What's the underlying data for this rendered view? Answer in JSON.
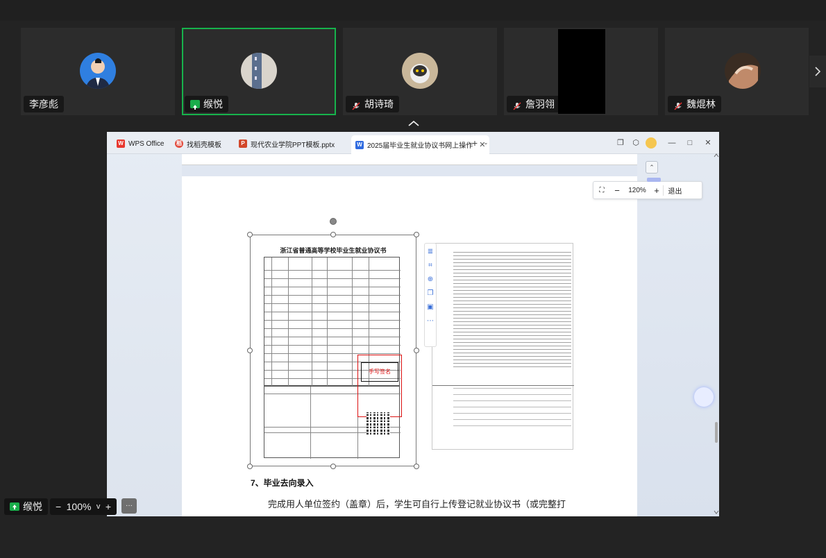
{
  "participants": [
    {
      "name": "李彦彪",
      "muted": false,
      "active": false
    },
    {
      "name": "缑悦",
      "muted": false,
      "active": true,
      "sharing": true
    },
    {
      "name": "胡诗琦",
      "muted": true,
      "active": false
    },
    {
      "name": "詹羽翎",
      "muted": true,
      "active": false
    },
    {
      "name": "魏焜林",
      "muted": true,
      "active": false
    }
  ],
  "browser_tabs": [
    {
      "label": "WPS Office",
      "icon": "wps-icon"
    },
    {
      "label": "找稻壳模板",
      "icon": "docer-icon"
    },
    {
      "label": "现代农业学院PPT模板.pptx",
      "icon": "ppt-icon"
    },
    {
      "label": "2025届毕业生就业协议书网上操作",
      "icon": "word-icon",
      "current": true
    }
  ],
  "zoom_toolbar": {
    "minus": "−",
    "value": "120%",
    "plus": "+",
    "exit": "退出"
  },
  "document": {
    "scan_title": "浙江省普通高等学校毕业生就业协议书",
    "signature_label": "手写签名",
    "heading": "7、毕业去向录入",
    "body": "完成用人单位签约（盖章）后，学生可自行上传登记就业协议书（或完整打"
  },
  "bottom": {
    "sharer": "缑悦",
    "zoom_minus": "−",
    "zoom_value": "100%",
    "zoom_caret": "v",
    "zoom_plus": "+",
    "more": "···"
  },
  "colors": {
    "active_border": "#17b34c",
    "share_green": "#1aad4b",
    "signature_red": "#dd1111"
  }
}
